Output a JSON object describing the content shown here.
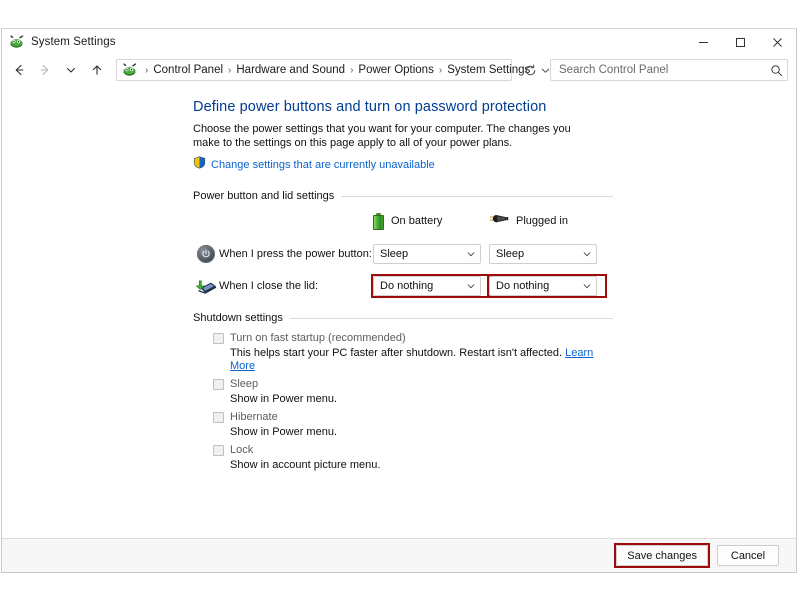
{
  "window": {
    "title": "System Settings",
    "icon": "control-panel-icon",
    "controls": {
      "minimize": "Minimize",
      "maximize": "Maximize",
      "close": "Close"
    }
  },
  "toolbar": {
    "back": "Back",
    "forward": "Forward",
    "recent": "Recent locations",
    "up": "Up",
    "refresh": "Refresh",
    "breadcrumb": [
      "Control Panel",
      "Hardware and Sound",
      "Power Options",
      "System Settings"
    ],
    "separator": "›"
  },
  "search": {
    "placeholder": "Search Control Panel",
    "value": ""
  },
  "main": {
    "heading": "Define power buttons and turn on password protection",
    "description": "Choose the power settings that you want for your computer. The changes you make to the settings on this page apply to all of your power plans.",
    "uac_link": "Change settings that are currently unavailable",
    "group_power": "Power button and lid settings",
    "columns": [
      {
        "icon": "battery-icon",
        "label": "On battery"
      },
      {
        "icon": "power-plug-icon",
        "label": "Plugged in"
      }
    ],
    "rows": [
      {
        "icon": "power-button-icon",
        "label": "When I press the power button:",
        "on_battery": "Sleep",
        "plugged_in": "Sleep",
        "highlighted": false
      },
      {
        "icon": "laptop-lid-icon",
        "label": "When I close the lid:",
        "on_battery": "Do nothing",
        "plugged_in": "Do nothing",
        "highlighted": true
      }
    ],
    "group_shutdown": "Shutdown settings",
    "checkboxes": [
      {
        "label": "Turn on fast startup (recommended)",
        "sublabel": "This helps start your PC faster after shutdown. Restart isn't affected.",
        "link": "Learn More",
        "checked": false
      },
      {
        "label": "Sleep",
        "sublabel": "Show in Power menu.",
        "link": "",
        "checked": false
      },
      {
        "label": "Hibernate",
        "sublabel": "Show in Power menu.",
        "link": "",
        "checked": false
      },
      {
        "label": "Lock",
        "sublabel": "Show in account picture menu.",
        "link": "",
        "checked": false
      }
    ]
  },
  "footer": {
    "save": "Save changes",
    "cancel": "Cancel",
    "save_highlighted": true
  },
  "colors": {
    "heading": "#003c94",
    "link": "#0b63ce",
    "highlight": "#9c0c0c",
    "battery": "#3f8f2b"
  }
}
